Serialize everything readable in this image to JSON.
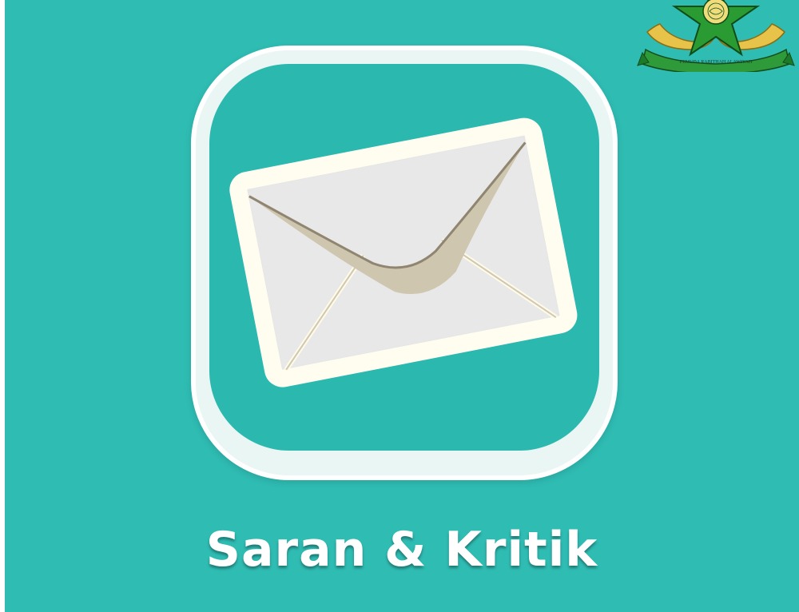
{
  "title": "Saran & Kritik",
  "logo": {
    "text": "PEMUDA RABITHAH ALAWIYAH",
    "icon": "organization-emblem"
  },
  "app_icon": {
    "icon": "envelope-icon"
  },
  "colors": {
    "background": "#2fbcb3",
    "icon_tile": "#2bb8af",
    "icon_frame": "#e9f6f4",
    "envelope_body": "#e6e6e6",
    "envelope_border": "#fffdf0",
    "envelope_fold": "#cfc7b4",
    "title_text": "#ffffff",
    "emblem_green": "#1f8a2c",
    "emblem_gold": "#e0b93a"
  }
}
